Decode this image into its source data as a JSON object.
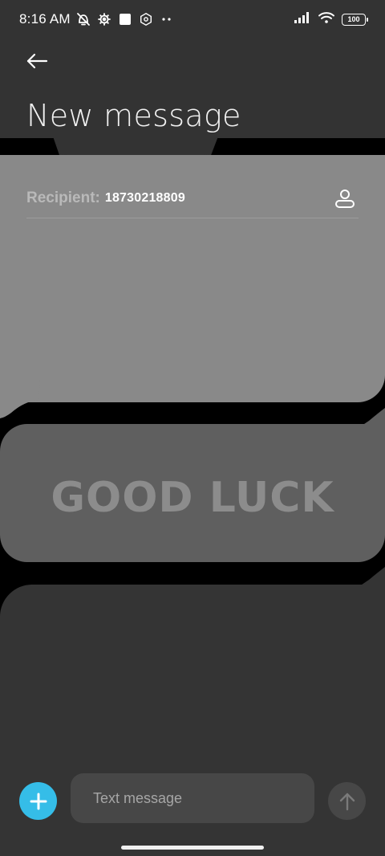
{
  "status_bar": {
    "time": "8:16 AM",
    "icons": [
      "alarm-off-icon",
      "settings-icon",
      "square-icon",
      "hex-icon",
      "more-dots-icon"
    ],
    "right_icons": [
      "signal-icon",
      "wifi-icon",
      "battery-icon"
    ],
    "battery": "100"
  },
  "header": {
    "title": "New message"
  },
  "recipient": {
    "label": "Recipient:",
    "value": "18730218809"
  },
  "background_card": {
    "text": "GOOD LUCK"
  },
  "composer": {
    "placeholder": "Text message",
    "add_icon": "plus-icon",
    "send_icon": "arrow-up-icon"
  },
  "colors": {
    "header_bg": "#333333",
    "card_light": "#898989",
    "card_mid": "#5f5f5f",
    "card_dark": "#343434",
    "accent": "#35bde8"
  }
}
